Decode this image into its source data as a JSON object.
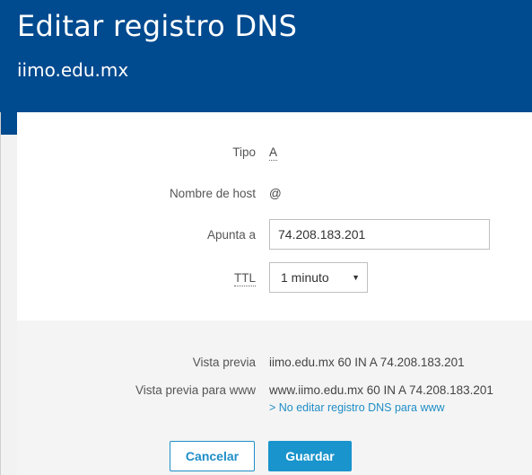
{
  "header": {
    "title": "Editar registro DNS",
    "domain": "iimo.edu.mx"
  },
  "form": {
    "tipo_label": "Tipo",
    "tipo_value": "A",
    "host_label": "Nombre de host",
    "host_value": "@",
    "points_to_label": "Apunta a",
    "points_to_value": "74.208.183.201",
    "ttl_label": "TTL",
    "ttl_value": "1 minuto",
    "ttl_caret": "▼"
  },
  "preview": {
    "preview_label": "Vista previa",
    "preview_value": "iimo.edu.mx  60  IN  A  74.208.183.201",
    "www_label": "Vista previa para www",
    "www_value": "www.iimo.edu.mx  60  IN  A  74.208.183.201",
    "no_edit_link": "> No editar registro DNS para www"
  },
  "actions": {
    "cancel_label": "Cancelar",
    "save_label": "Guardar"
  },
  "colors": {
    "header_bg": "#004a8f",
    "accent": "#1994cc"
  }
}
